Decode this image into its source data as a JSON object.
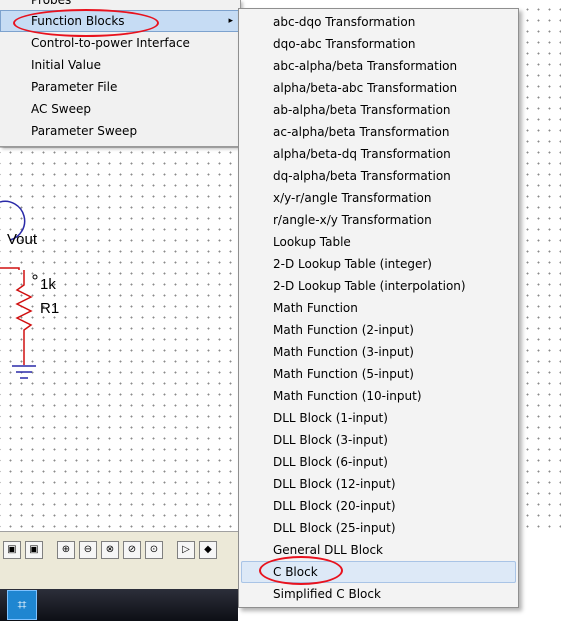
{
  "parent_menu": {
    "items": [
      {
        "label": "Probes",
        "has_submenu": false
      },
      {
        "label": "Function Blocks",
        "has_submenu": true,
        "active": true
      },
      {
        "label": "Control-to-power Interface",
        "has_submenu": false
      },
      {
        "label": "Initial Value",
        "has_submenu": false
      },
      {
        "label": "Parameter File",
        "has_submenu": false
      },
      {
        "label": "AC Sweep",
        "has_submenu": false
      },
      {
        "label": "Parameter Sweep",
        "has_submenu": false
      }
    ],
    "submenu_arrow": "▸"
  },
  "submenu": {
    "items": [
      {
        "label": "abc-dqo Transformation"
      },
      {
        "label": "dqo-abc Transformation"
      },
      {
        "label": "abc-alpha/beta Transformation"
      },
      {
        "label": "alpha/beta-abc Transformation"
      },
      {
        "label": "ab-alpha/beta Transformation"
      },
      {
        "label": "ac-alpha/beta Transformation"
      },
      {
        "label": "alpha/beta-dq Transformation"
      },
      {
        "label": "dq-alpha/beta Transformation"
      },
      {
        "label": "x/y-r/angle Transformation"
      },
      {
        "label": "r/angle-x/y Transformation"
      },
      {
        "label": "Lookup Table"
      },
      {
        "label": "2-D Lookup Table (integer)"
      },
      {
        "label": "2-D Lookup Table (interpolation)"
      },
      {
        "label": "Math Function"
      },
      {
        "label": "Math Function (2-input)"
      },
      {
        "label": "Math Function (3-input)"
      },
      {
        "label": "Math Function (5-input)"
      },
      {
        "label": "Math Function (10-input)"
      },
      {
        "label": "DLL Block (1-input)"
      },
      {
        "label": "DLL Block (3-input)"
      },
      {
        "label": "DLL Block (6-input)"
      },
      {
        "label": "DLL Block (12-input)"
      },
      {
        "label": "DLL Block (20-input)"
      },
      {
        "label": "DLL Block (25-input)"
      },
      {
        "label": "General DLL Block"
      },
      {
        "label": "C Block",
        "hover": true
      },
      {
        "label": "Simplified C Block"
      }
    ]
  },
  "schematic": {
    "node_label": "Vout",
    "resistor_value": "1k",
    "resistor_name": "R1"
  },
  "colors": {
    "annotation": "#e8121e",
    "menu_active": "#c6dcf4",
    "menu_hover": "#dde9f7",
    "wire_red": "#d01010",
    "wire_blue": "#2a2aa8"
  },
  "toolbar": {
    "icons": [
      "meter-icon-1",
      "meter-icon-2",
      "voltage-probe-icon",
      "current-probe-icon",
      "probe-icon-3",
      "probe-icon-4",
      "probe-icon-5",
      "diode-icon",
      "transistor-icon"
    ]
  }
}
